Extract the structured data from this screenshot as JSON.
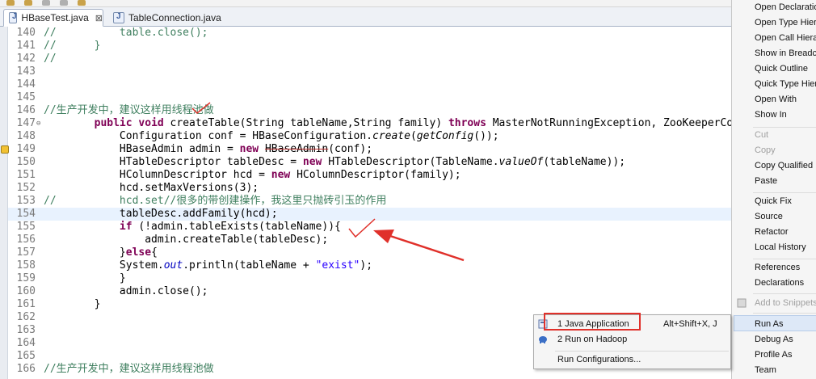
{
  "tabs": [
    {
      "label": "HBaseTest.java",
      "close": "⊠",
      "active": true
    },
    {
      "label": "TableConnection.java",
      "active": false
    }
  ],
  "editor": {
    "lines": [
      {
        "num": "140",
        "parts": [
          {
            "t": "//          table.close();",
            "c": "cm"
          }
        ]
      },
      {
        "num": "141",
        "parts": [
          {
            "t": "//      }",
            "c": "cm"
          }
        ]
      },
      {
        "num": "142",
        "parts": [
          {
            "t": "//",
            "c": "cm"
          }
        ]
      },
      {
        "num": "143",
        "parts": []
      },
      {
        "num": "144",
        "parts": []
      },
      {
        "num": "145",
        "parts": []
      },
      {
        "num": "146",
        "parts": [
          {
            "t": "//生产开发中，建议这样用线程池做",
            "c": "cm"
          }
        ]
      },
      {
        "num": "147",
        "fold": "⊖",
        "parts": [
          {
            "t": "        "
          },
          {
            "t": "public",
            "c": "kw"
          },
          {
            "t": " "
          },
          {
            "t": "void",
            "c": "kw"
          },
          {
            "t": " createTable(String tableName,String family) "
          },
          {
            "t": "throws",
            "c": "kw"
          },
          {
            "t": " MasterNotRunningException, ZooKeeperConn"
          }
        ]
      },
      {
        "num": "148",
        "parts": [
          {
            "t": "            Configuration conf = HBaseConfiguration."
          },
          {
            "t": "create",
            "c": "it"
          },
          {
            "t": "("
          },
          {
            "t": "getConfig",
            "c": "it"
          },
          {
            "t": "());"
          }
        ]
      },
      {
        "num": "149",
        "warn": true,
        "parts": [
          {
            "t": "            HBaseAdmin admin = "
          },
          {
            "t": "new",
            "c": "kw"
          },
          {
            "t": " "
          },
          {
            "t": "HBaseAdmin",
            "c": "strike"
          },
          {
            "t": "(conf);"
          }
        ]
      },
      {
        "num": "150",
        "parts": [
          {
            "t": "            HTableDescriptor tableDesc = "
          },
          {
            "t": "new",
            "c": "kw"
          },
          {
            "t": " HTableDescriptor(TableName."
          },
          {
            "t": "valueOf",
            "c": "it"
          },
          {
            "t": "(tableName));"
          }
        ]
      },
      {
        "num": "151",
        "parts": [
          {
            "t": "            HColumnDescriptor hcd = "
          },
          {
            "t": "new",
            "c": "kw"
          },
          {
            "t": " HColumnDescriptor(family);"
          }
        ]
      },
      {
        "num": "152",
        "parts": [
          {
            "t": "            hcd.setMaxVersions(3);"
          }
        ]
      },
      {
        "num": "153",
        "parts": [
          {
            "t": "//          hcd.set//很多的带创建操作，我这里只抛砖引玉的作用",
            "c": "cm"
          }
        ]
      },
      {
        "num": "154",
        "current": true,
        "parts": [
          {
            "t": "            tableDesc.addFamily(hcd);"
          }
        ]
      },
      {
        "num": "155",
        "parts": [
          {
            "t": "            "
          },
          {
            "t": "if",
            "c": "kw"
          },
          {
            "t": " (!admin.tableExists(tableName)){"
          }
        ]
      },
      {
        "num": "156",
        "parts": [
          {
            "t": "                admin.createTable(tableDesc);"
          }
        ]
      },
      {
        "num": "157",
        "parts": [
          {
            "t": "            }"
          },
          {
            "t": "else",
            "c": "kw"
          },
          {
            "t": "{"
          }
        ]
      },
      {
        "num": "158",
        "parts": [
          {
            "t": "            System."
          },
          {
            "t": "out",
            "c": "fld"
          },
          {
            "t": ".println(tableName + "
          },
          {
            "t": "\"exist\"",
            "c": "str"
          },
          {
            "t": ");"
          }
        ]
      },
      {
        "num": "159",
        "parts": [
          {
            "t": "            }"
          }
        ]
      },
      {
        "num": "160",
        "parts": [
          {
            "t": "            admin.close();"
          }
        ]
      },
      {
        "num": "161",
        "parts": [
          {
            "t": "        }"
          }
        ]
      },
      {
        "num": "162",
        "parts": []
      },
      {
        "num": "163",
        "parts": []
      },
      {
        "num": "164",
        "parts": []
      },
      {
        "num": "165",
        "parts": []
      },
      {
        "num": "166",
        "parts": [
          {
            "t": "//生产开发中，建议这样用线程池做",
            "c": "cm"
          }
        ]
      }
    ]
  },
  "context_menu": {
    "items": [
      {
        "label": "Open Declaration",
        "disabled": false
      },
      {
        "label": "Open Type Hierarchy",
        "disabled": false
      },
      {
        "label": "Open Call Hierarchy",
        "disabled": false
      },
      {
        "label": "Show in Breadcrumb",
        "disabled": false
      },
      {
        "label": "Quick Outline",
        "disabled": false
      },
      {
        "label": "Quick Type Hierarchy",
        "disabled": false
      },
      {
        "label": "Open With",
        "disabled": false
      },
      {
        "label": "Show In",
        "disabled": false
      },
      {
        "label": "Cut",
        "disabled": true
      },
      {
        "label": "Copy",
        "disabled": true
      },
      {
        "label": "Copy Qualified Name",
        "disabled": false
      },
      {
        "label": "Paste",
        "disabled": false
      },
      {
        "label": "Quick Fix",
        "disabled": false
      },
      {
        "label": "Source",
        "disabled": false
      },
      {
        "label": "Refactor",
        "disabled": false
      },
      {
        "label": "Local History",
        "disabled": false
      },
      {
        "label": "References",
        "disabled": false
      },
      {
        "label": "Declarations",
        "disabled": false
      },
      {
        "label": "Add to Snippets...",
        "disabled": true
      },
      {
        "label": "Run As",
        "disabled": false
      },
      {
        "label": "Debug As",
        "disabled": false
      },
      {
        "label": "Profile As",
        "disabled": false
      },
      {
        "label": "Team",
        "disabled": false
      }
    ]
  },
  "submenu": {
    "items": [
      {
        "label": "1 Java Application",
        "shortcut": "Alt+Shift+X, J",
        "icon": "java-application-icon"
      },
      {
        "label": "2 Run on Hadoop",
        "shortcut": "",
        "icon": "hadoop-elephant-icon"
      },
      {
        "label": "Run Configurations...",
        "shortcut": "",
        "icon": ""
      }
    ]
  },
  "colors": {
    "keyword": "#7f0055",
    "comment": "#3f7f5f",
    "string": "#2a00ff",
    "annotation_red": "#e0302a",
    "current_line": "#e8f2fe"
  }
}
